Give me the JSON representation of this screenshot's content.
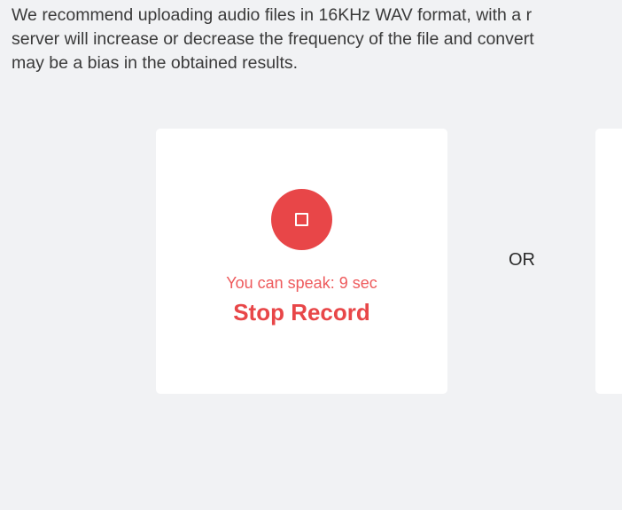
{
  "notice": {
    "line1": "We recommend uploading audio files in 16KHz WAV format, with a r",
    "line2": "server will increase or decrease the frequency of the file and convert",
    "line3": "may be a bias in the obtained results."
  },
  "recorder": {
    "countdown_text": "You can speak: 9 sec",
    "stop_label": "Stop Record",
    "button_icon": "stop-icon",
    "accent_color": "#e84648"
  },
  "separator": {
    "label": "OR"
  }
}
